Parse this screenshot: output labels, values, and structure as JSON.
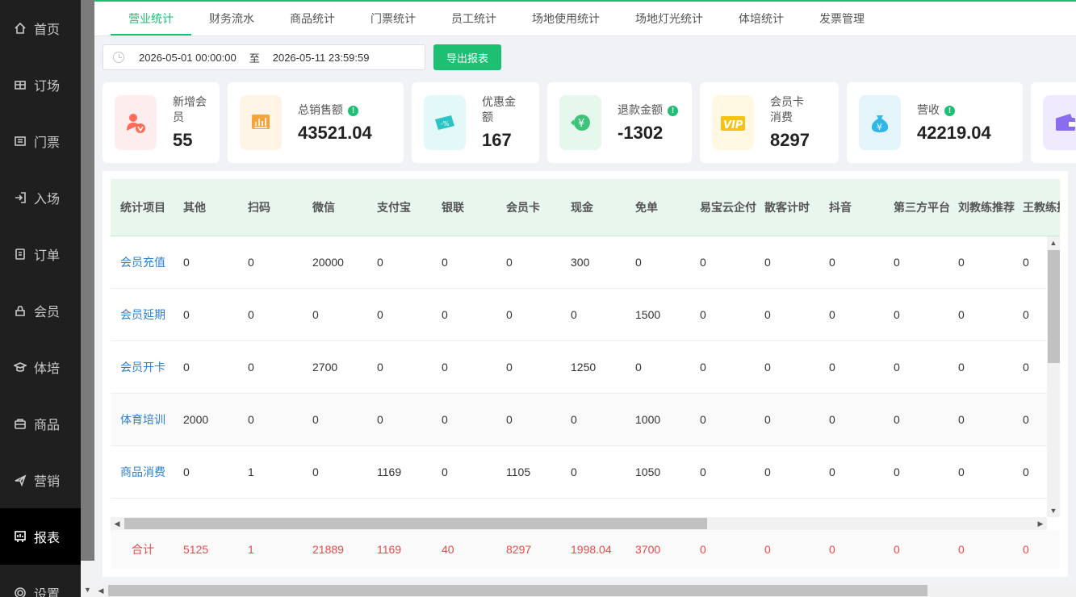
{
  "sidebar": {
    "items": [
      {
        "label": "首页",
        "icon": "home-icon"
      },
      {
        "label": "订场",
        "icon": "court-booking-icon"
      },
      {
        "label": "门票",
        "icon": "ticket-icon"
      },
      {
        "label": "入场",
        "icon": "entry-icon"
      },
      {
        "label": "订单",
        "icon": "order-icon"
      },
      {
        "label": "会员",
        "icon": "member-icon"
      },
      {
        "label": "体培",
        "icon": "training-icon"
      },
      {
        "label": "商品",
        "icon": "goods-icon"
      },
      {
        "label": "营销",
        "icon": "marketing-icon"
      },
      {
        "label": "报表",
        "icon": "report-icon"
      },
      {
        "label": "设置",
        "icon": "settings-icon"
      }
    ],
    "active_index": 9
  },
  "tabs": [
    "营业统计",
    "财务流水",
    "商品统计",
    "门票统计",
    "员工统计",
    "场地使用统计",
    "场地灯光统计",
    "体培统计",
    "发票管理"
  ],
  "filter": {
    "start": "2026-05-01 00:00:00",
    "separator": "至",
    "end": "2026-05-11 23:59:59",
    "export_label": "导出报表"
  },
  "cards": [
    {
      "label": "新增会员",
      "value": "55",
      "info": false,
      "icon": "new-member-icon",
      "color": "#ff6b5b",
      "bg": "#fdeeed"
    },
    {
      "label": "总销售额",
      "value": "43521.04",
      "info": true,
      "icon": "sales-chart-icon",
      "color": "#f5a33b",
      "bg": "#fef4e6"
    },
    {
      "label": "优惠金额",
      "value": "167",
      "info": false,
      "icon": "discount-coupon-icon",
      "color": "#2bc4c4",
      "bg": "#e3f8f8"
    },
    {
      "label": "退款金额",
      "value": "-1302",
      "info": true,
      "icon": "refund-icon",
      "color": "#3ec47a",
      "bg": "#e6f7ee"
    },
    {
      "label": "会员卡消费",
      "value": "8297",
      "info": false,
      "icon": "vip-card-icon",
      "color": "#f5c211",
      "bg": "#fff9e3"
    },
    {
      "label": "营收",
      "value": "42219.04",
      "info": true,
      "icon": "money-bag-icon",
      "color": "#31b6ea",
      "bg": "#e3f4fb"
    },
    {
      "label": "",
      "value": "",
      "info": false,
      "icon": "wallet-icon",
      "color": "#8a6cf0",
      "bg": "#efeafd"
    }
  ],
  "table": {
    "headers": [
      "统计项目",
      "其他",
      "扫码",
      "微信",
      "支付宝",
      "银联",
      "会员卡",
      "现金",
      "免单",
      "易宝云企付",
      "散客计时",
      "抖音",
      "第三方平台",
      "刘教练推荐",
      "王教练推荐"
    ],
    "rows": [
      [
        "会员充值",
        "0",
        "0",
        "20000",
        "0",
        "0",
        "0",
        "300",
        "0",
        "0",
        "0",
        "0",
        "0",
        "0",
        "0"
      ],
      [
        "会员延期",
        "0",
        "0",
        "0",
        "0",
        "0",
        "0",
        "0",
        "1500",
        "0",
        "0",
        "0",
        "0",
        "0",
        "0"
      ],
      [
        "会员开卡",
        "0",
        "0",
        "2700",
        "0",
        "0",
        "0",
        "1250",
        "0",
        "0",
        "0",
        "0",
        "0",
        "0",
        "0"
      ],
      [
        "体育培训",
        "2000",
        "0",
        "0",
        "0",
        "0",
        "0",
        "0",
        "1000",
        "0",
        "0",
        "0",
        "0",
        "0",
        "0"
      ],
      [
        "商品消费",
        "0",
        "1",
        "0",
        "1169",
        "0",
        "1105",
        "0",
        "1050",
        "0",
        "0",
        "0",
        "0",
        "0",
        "0"
      ]
    ],
    "total": [
      "合计",
      "5125",
      "1",
      "21889",
      "1169",
      "40",
      "8297",
      "1998.04",
      "3700",
      "0",
      "0",
      "0",
      "0",
      "0",
      "0"
    ]
  }
}
